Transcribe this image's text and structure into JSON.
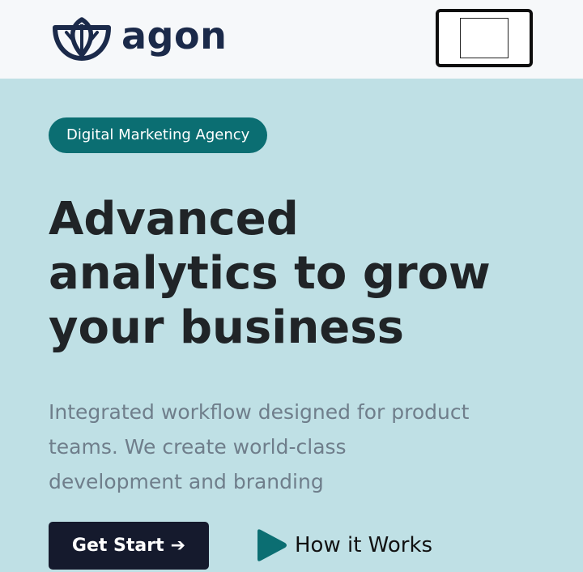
{
  "header": {
    "brand_name": "agon",
    "brand_icon": "leaf-shield-logo-icon",
    "menu_icon": "menu-toggle-icon"
  },
  "hero": {
    "badge": "Digital Marketing Agency",
    "headline": [
      "Advanced",
      "analytics to grow",
      "your business"
    ],
    "description": [
      "Integrated workflow designed for product",
      "teams. We create world-class",
      "development and branding"
    ],
    "primary_cta": "Get Start",
    "primary_cta_icon": "arrow-right-icon",
    "secondary_cta": "How it Works",
    "secondary_cta_icon": "play-icon"
  },
  "colors": {
    "hero_background": "#bfe0e5",
    "header_background": "#f6f8fa",
    "accent_teal": "#0b6e72",
    "brand_navy": "#1b2a4a",
    "cta_background": "#151a2d",
    "headline_text": "#202427",
    "body_text": "#6f7e8b"
  }
}
